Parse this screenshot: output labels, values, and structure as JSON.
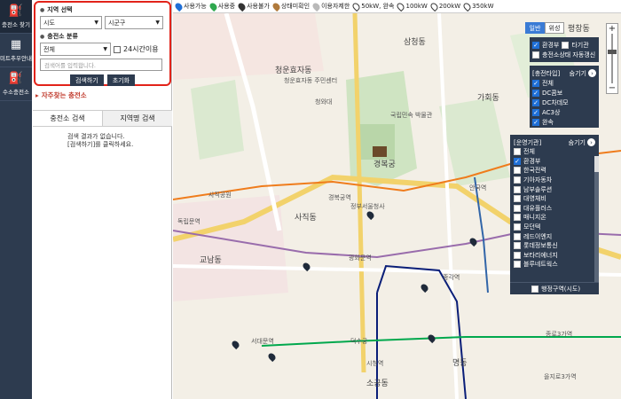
{
  "rail": [
    {
      "label": "충전소 찾기",
      "icon": "charger-icon",
      "glyph": "⛽"
    },
    {
      "label": "미트추우안내",
      "icon": "calendar-icon",
      "glyph": "▦"
    },
    {
      "label": "수소충전소",
      "icon": "hydrogen-station-icon",
      "glyph": "⛽"
    }
  ],
  "search": {
    "region_title": "지역 선택",
    "sido": "시도",
    "sigungu": "시군구",
    "type_title": "충전소 분류",
    "type_value": "전체",
    "hours_label": "24시간이용",
    "input_placeholder": "검색어를 입력합니다.",
    "search_btn": "검색하기",
    "reset_btn": "초기화"
  },
  "favorites": "자주찾는 충전소",
  "tabs": [
    "충전소 검색",
    "지역명 검색"
  ],
  "result": {
    "line1": "검색 결과가 없습니다.",
    "line2": "[검색하기]를 클릭하세요."
  },
  "legend": [
    {
      "label": "사용가능",
      "color": "#1f6fd6"
    },
    {
      "label": "사용중",
      "color": "#2fa84f"
    },
    {
      "label": "사용불가",
      "color": "#333333"
    },
    {
      "label": "상태미확인",
      "color": "#b07a3c"
    },
    {
      "label": "이용자제한",
      "color": "#b9b9b9"
    },
    {
      "label": "50kW, 완속",
      "color": "#ffffff"
    },
    {
      "label": "100kW",
      "color": "#ffffff"
    },
    {
      "label": "200kW",
      "color": "#ffffff"
    },
    {
      "label": "350kW",
      "color": "#ffffff"
    }
  ],
  "map_toggle": [
    "일반",
    "위성"
  ],
  "layers": [
    {
      "label": "환경부",
      "checked": true
    },
    {
      "label": "타기관",
      "checked": false
    },
    {
      "label": "충전소상태 자동갱신",
      "checked": false
    }
  ],
  "type_panel": {
    "title": "[충전타입]",
    "hide": "숨기기",
    "items": [
      {
        "label": "전체",
        "checked": true
      },
      {
        "label": "DC콤보",
        "checked": true
      },
      {
        "label": "DC차데모",
        "checked": true
      },
      {
        "label": "AC3상",
        "checked": true
      },
      {
        "label": "완속",
        "checked": true
      }
    ]
  },
  "op_panel": {
    "title": "[운영기관]",
    "hide": "숨기기",
    "items": [
      {
        "label": "전체",
        "checked": false
      },
      {
        "label": "환경부",
        "checked": true
      },
      {
        "label": "한국전력",
        "checked": false
      },
      {
        "label": "기아자동차",
        "checked": false
      },
      {
        "label": "남부솔루션",
        "checked": false
      },
      {
        "label": "대영채비",
        "checked": false
      },
      {
        "label": "대유플러스",
        "checked": false
      },
      {
        "label": "매니지온",
        "checked": false
      },
      {
        "label": "모던텍",
        "checked": false
      },
      {
        "label": "레드이엔지",
        "checked": false
      },
      {
        "label": "롯데정보통신",
        "checked": false
      },
      {
        "label": "보타리에너지",
        "checked": false
      },
      {
        "label": "블루네트웍스",
        "checked": false
      }
    ],
    "footer": "행정구역(시도)"
  },
  "map_labels": [
    "청운효자동",
    "청운효자동 주민센터",
    "삼청동",
    "가회동",
    "국립민속 박물관",
    "경복궁",
    "청와대",
    "사직동",
    "교남동",
    "광화문역",
    "경복궁역",
    "독립문역",
    "서대문역",
    "종각역",
    "종로3가역",
    "안국역",
    "평창동",
    "정부서울청사",
    "사직공원",
    "을지로3가역",
    "시청역",
    "덕수궁",
    "명동",
    "소공동"
  ]
}
